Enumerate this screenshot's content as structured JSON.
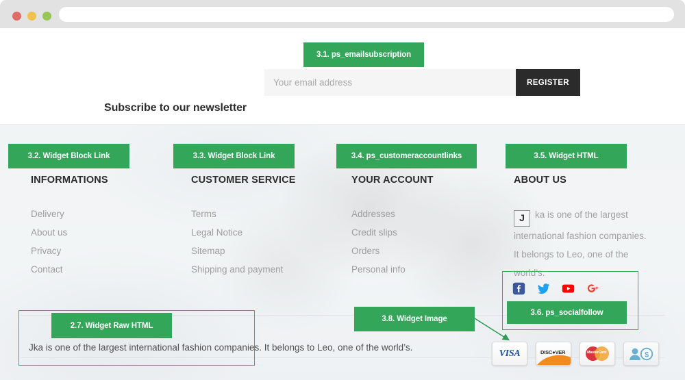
{
  "browser": {
    "url_value": "",
    "url_placeholder": "",
    "traffic_lights": [
      "close-red",
      "minimize-yellow",
      "maximize-green"
    ]
  },
  "colors": {
    "annotation_green": "#34a65a",
    "outline_green": "#3faa62",
    "register_dark": "#2b2b2b",
    "footer_bg": "#f2f5f6",
    "input_bg": "#f5f5f5",
    "link_gray": "#9d9d9d"
  },
  "newsletter": {
    "annotation": "3.1. ps_emailsubscription",
    "title": "Subscribe to our newsletter",
    "email_placeholder": "Your email address",
    "email_value": "",
    "register_label": "REGISTER"
  },
  "footer": {
    "columns": [
      {
        "annotation": "3.2. Widget Block Link",
        "heading": "INFORMATIONS",
        "links": [
          "Delivery",
          "About us",
          "Privacy",
          "Contact"
        ]
      },
      {
        "annotation": "3.3. Widget Block Link",
        "heading": "CUSTOMER SERVICE",
        "links": [
          "Terms",
          "Legal Notice",
          "Sitemap",
          "Shipping and payment"
        ]
      },
      {
        "annotation": "3.4. ps_customeraccountlinks",
        "heading": "YOUR ACCOUNT",
        "links": [
          "Addresses",
          "Credit slips",
          "Orders",
          "Personal info"
        ]
      }
    ],
    "about": {
      "annotation": "3.5. Widget HTML",
      "heading": "ABOUT US",
      "brand_initial": "J",
      "text": "ka is one of the largest international fashion companies. It belongs to Leo, one of the world’s."
    },
    "social": {
      "annotation": "3.6. ps_socialfollow",
      "networks": [
        "facebook-icon",
        "twitter-icon",
        "youtube-icon",
        "google-plus-icon"
      ]
    },
    "raw_html": {
      "annotation": "2.7. Widget Raw HTML",
      "text": "Jka is one of the largest international fashion companies. It belongs to Leo, one of the world’s."
    },
    "widget_image": {
      "annotation": "3.8. Widget Image",
      "payments": [
        {
          "name": "visa-card-icon",
          "label": "VISA"
        },
        {
          "name": "discover-card-icon",
          "label": "DISC●VER"
        },
        {
          "name": "mastercard-card-icon",
          "label": "MasterCard"
        },
        {
          "name": "paypal-card-icon",
          "label": ""
        }
      ]
    }
  }
}
